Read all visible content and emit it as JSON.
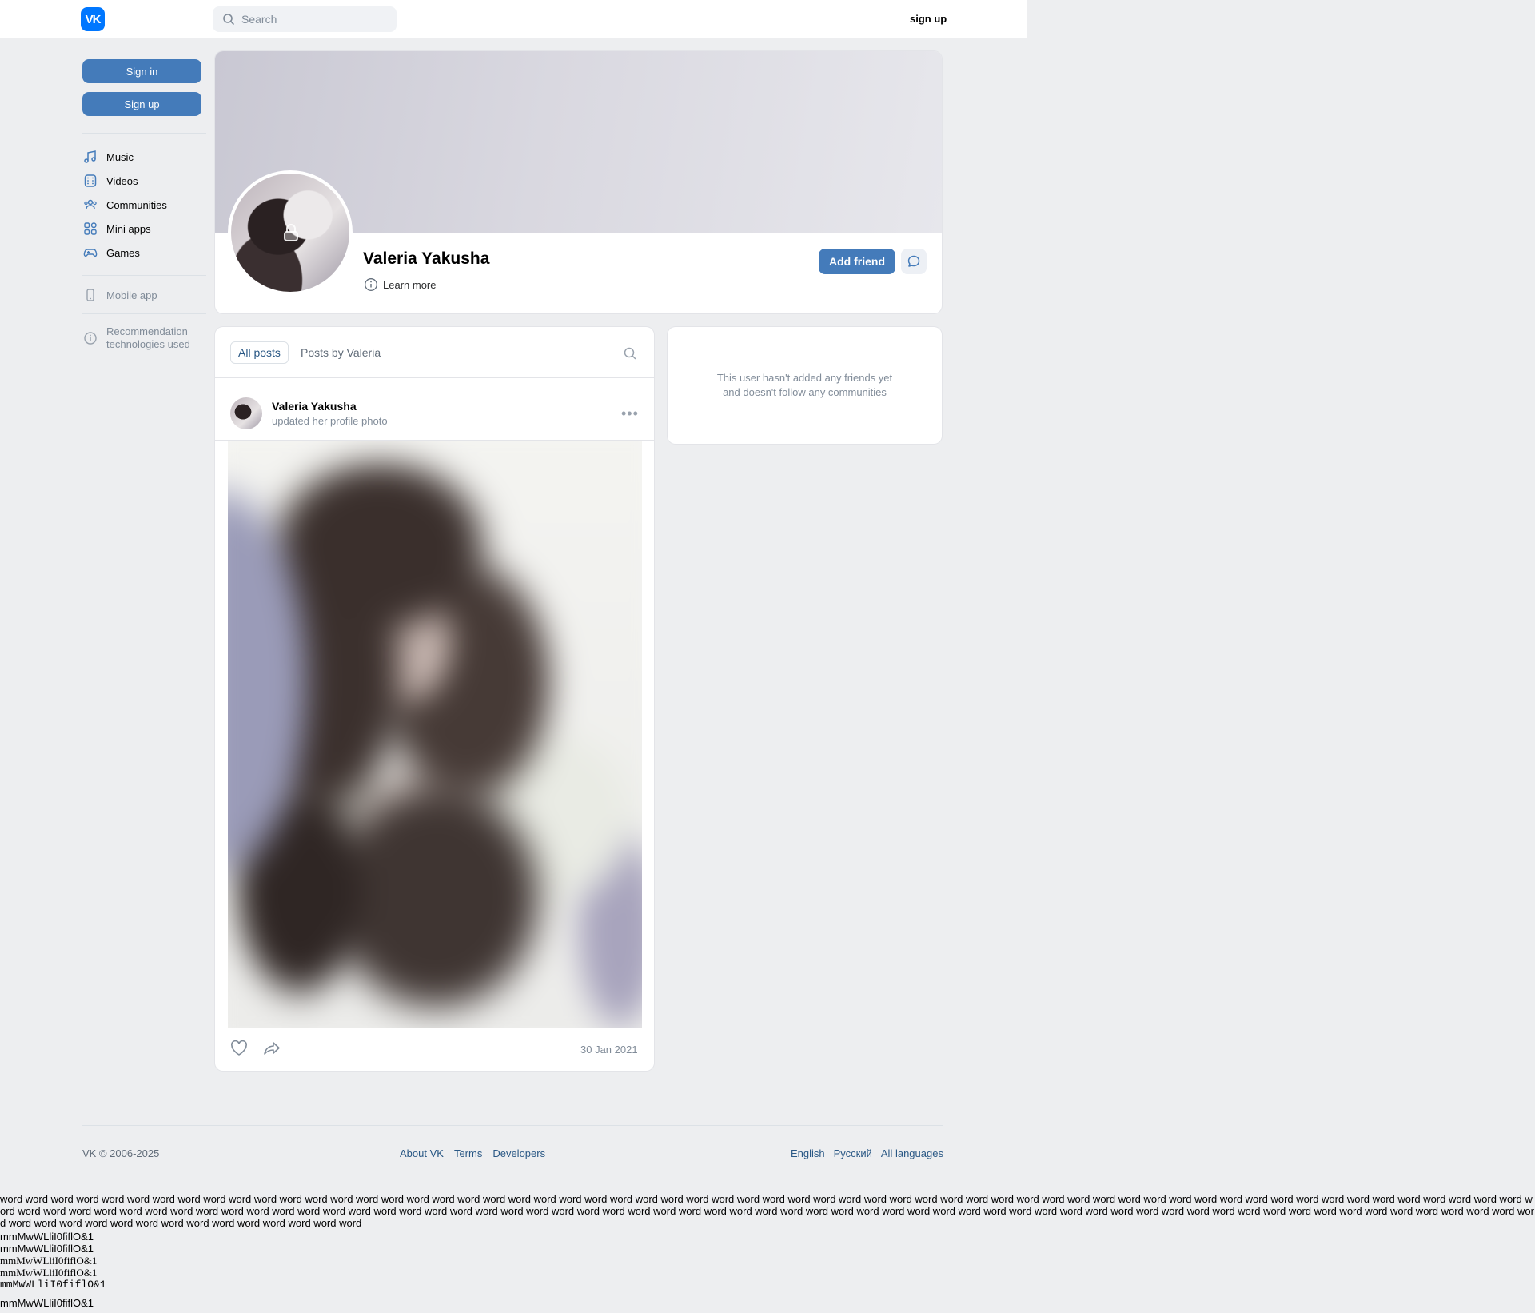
{
  "header": {
    "logo_text": "VK",
    "search_placeholder": "Search",
    "signup_link": "sign up"
  },
  "sidebar": {
    "sign_in": "Sign in",
    "sign_up": "Sign up",
    "items": [
      {
        "label": "Music",
        "icon": "music-note-icon"
      },
      {
        "label": "Videos",
        "icon": "video-icon"
      },
      {
        "label": "Communities",
        "icon": "users-icon"
      },
      {
        "label": "Mini apps",
        "icon": "grid-icon"
      },
      {
        "label": "Games",
        "icon": "gamepad-icon"
      }
    ],
    "mobile_app": "Mobile app",
    "recommendation_line1": "Recommendation",
    "recommendation_line2": "technologies used"
  },
  "profile": {
    "name": "Valeria Yakusha",
    "learn_more": "Learn more",
    "add_friend": "Add friend"
  },
  "wall": {
    "tabs": [
      "All posts",
      "Posts by Valeria"
    ],
    "post": {
      "author": "Valeria Yakusha",
      "subtitle": "updated her profile photo",
      "date": "30 Jan 2021"
    }
  },
  "friends": {
    "line1": "This user hasn't added any friends yet",
    "line2": "and doesn't follow any communities"
  },
  "footer": {
    "copyright": "VK © 2006-2025",
    "links": [
      "About VK",
      "Terms",
      "Developers"
    ],
    "languages": [
      "English",
      "Русский",
      "All languages"
    ]
  },
  "test_text": {
    "words": "word word word word word word word word word word word word word word word word word word word word word word word word word word word word word word word word word word word word word word word word word word word word word word word word word word word word word word word word word word word word word word word word word word word word word word word word word word word word word word word word word word word word word word word word word word word word word word word word word word word word word word word word word word word word word word word word word word word word word word word word word word word word word word word word word word word word word word word",
    "lines": [
      "mmMwWLliI0fiflO&1",
      "mmMwWLliI0fiflO&1",
      "mmMwWLliI0fiflO&1",
      "mmMwWLliI0fiflO&1",
      "mmMwWLliI0fiflO&1",
      "mmMwWLliI0fiflO&1"
    ]
  },
  "colors": {
    "accent": "#447bba",
    "brand": "#0077ff",
    "link": "#2a5885",
    "page_bg": "#edeef0"
  }
}
